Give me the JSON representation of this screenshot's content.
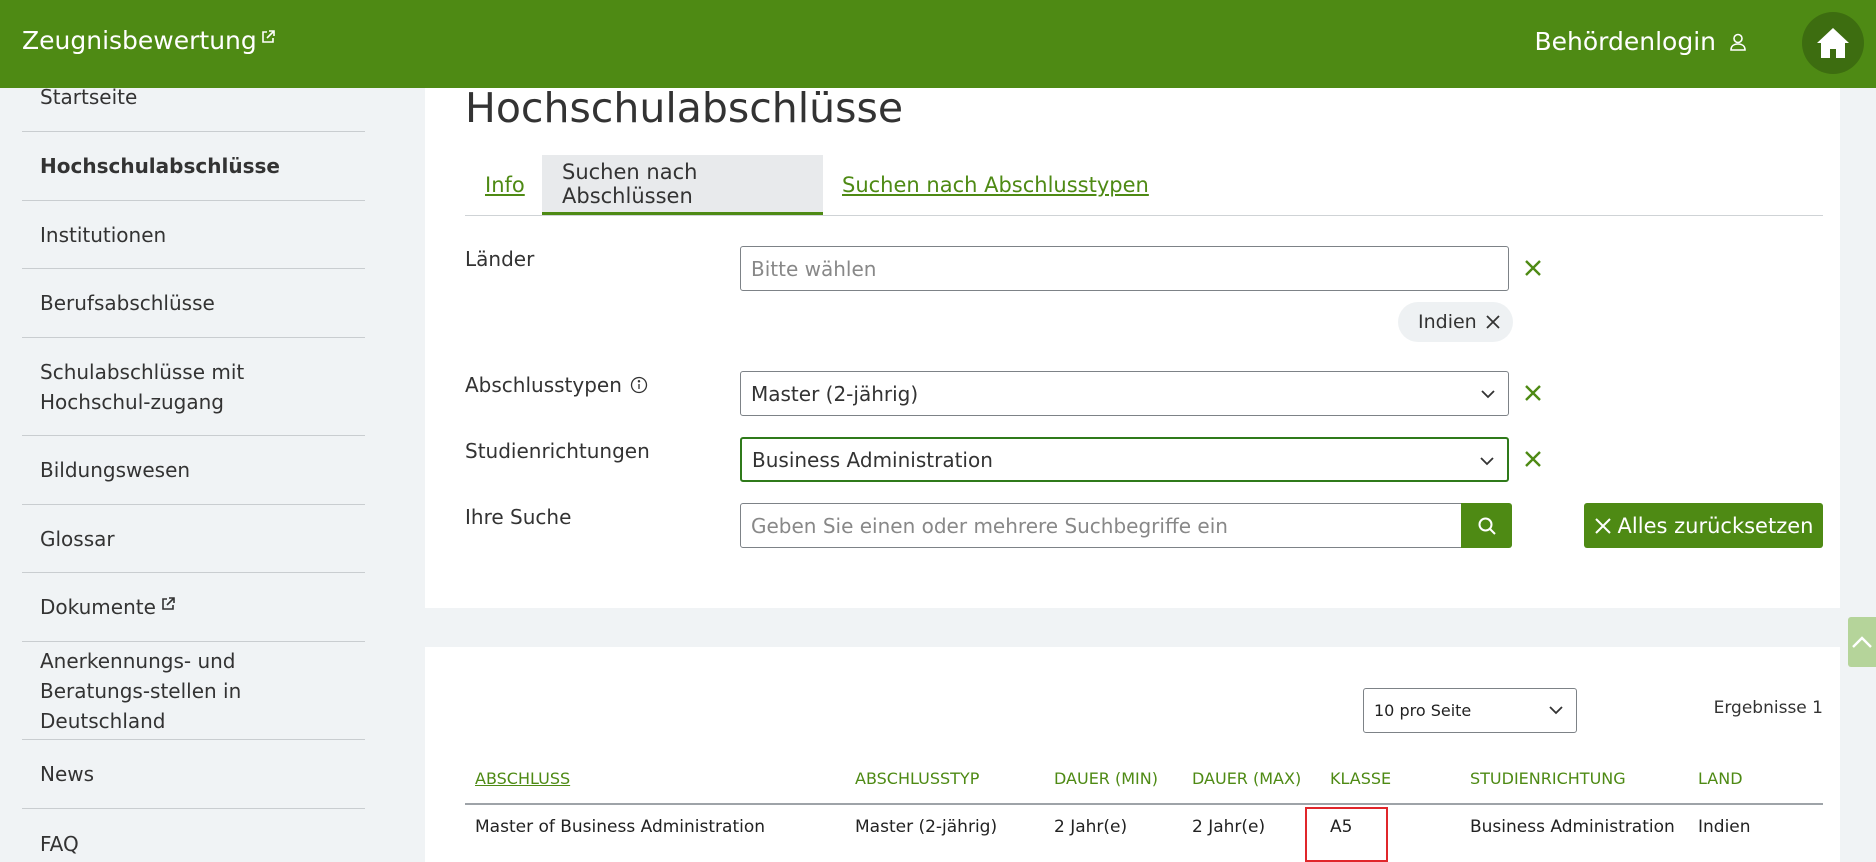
{
  "header": {
    "brand": "Zeugnisbewertung",
    "login_label": "Behördenlogin"
  },
  "sidebar": {
    "items": [
      {
        "label": "Startseite"
      },
      {
        "label": "Hochschulabschlüsse",
        "active": true
      },
      {
        "label": "Institutionen"
      },
      {
        "label": "Berufsabschlüsse"
      },
      {
        "label": "Schulabschlüsse mit Hochschul-zugang"
      },
      {
        "label": "Bildungswesen"
      },
      {
        "label": "Glossar"
      },
      {
        "label": "Dokumente",
        "external": true
      },
      {
        "label": "Anerkennungs- und Beratungs-stellen in Deutschland"
      },
      {
        "label": "News"
      },
      {
        "label": "FAQ"
      }
    ]
  },
  "main": {
    "title": "Hochschulabschlüsse",
    "tabs": [
      {
        "label": "Info"
      },
      {
        "label": "Suchen nach Abschlüssen",
        "selected": true
      },
      {
        "label": "Suchen nach Abschlusstypen"
      }
    ]
  },
  "form": {
    "countries_label": "Länder",
    "countries_placeholder": "Bitte wählen",
    "country_chip": "Indien",
    "degree_types_label": "Abschlusstypen",
    "degree_type_value": "Master (2-jährig)",
    "fields_label": "Studienrichtungen",
    "field_value": "Business Administration",
    "search_label": "Ihre Suche",
    "search_placeholder": "Geben Sie einen oder mehrere Suchbegriffe ein",
    "reset_label": "Alles zurücksetzen"
  },
  "results": {
    "per_page": "10 pro Seite",
    "count_label": "Ergebnisse 1",
    "columns": [
      "Abschluss",
      "Abschlusstyp",
      "Dauer (min)",
      "Dauer (max)",
      "Klasse",
      "Studienrichtung",
      "Land"
    ],
    "rows": [
      [
        "Master of Business Administration",
        "Master (2-jährig)",
        "2 Jahr(e)",
        "2 Jahr(e)",
        "A5",
        "Business Administration",
        "Indien"
      ]
    ]
  },
  "colors": {
    "brand_green": "#4e8a14",
    "highlight_red": "#e0262b"
  }
}
